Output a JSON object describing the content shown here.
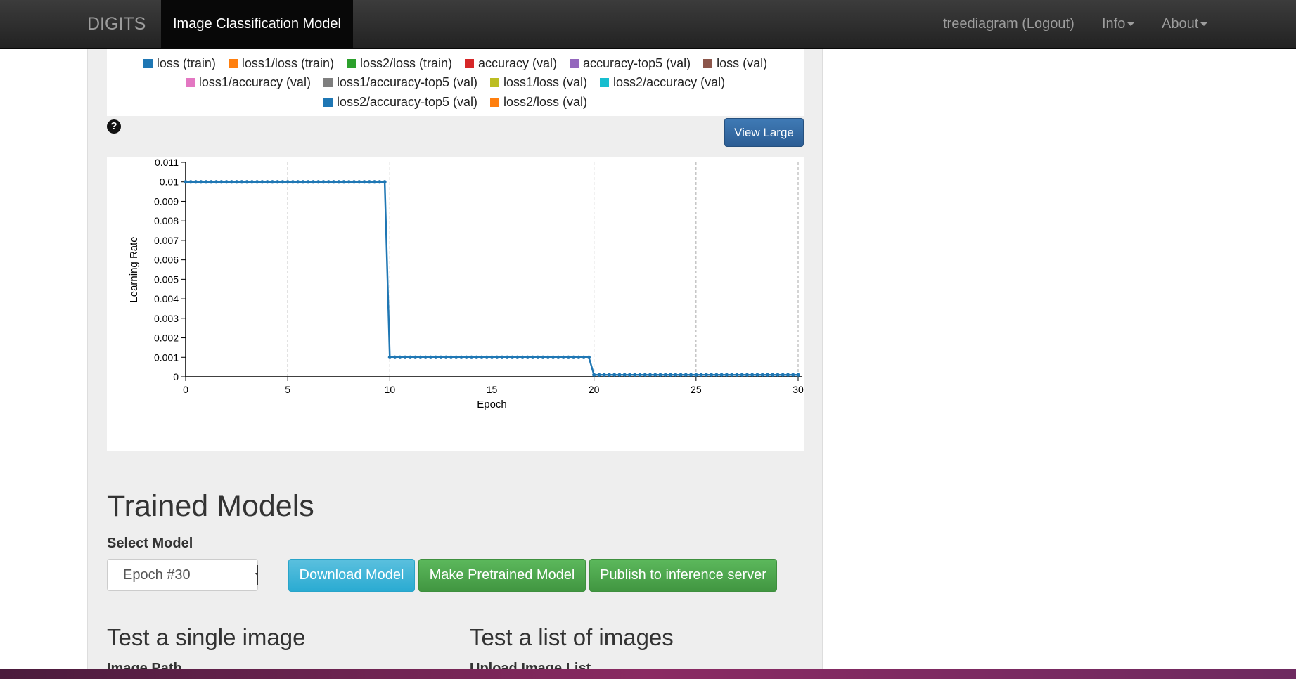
{
  "navbar": {
    "brand": "DIGITS",
    "active_tab": "Image Classification Model",
    "user_link": "treediagram (Logout)",
    "info_menu": "Info",
    "about_menu": "About"
  },
  "legend": {
    "items": [
      {
        "label": "loss (train)",
        "color": "#1f77b4"
      },
      {
        "label": "loss1/loss (train)",
        "color": "#ff7f0e"
      },
      {
        "label": "loss2/loss (train)",
        "color": "#2ca02c"
      },
      {
        "label": "accuracy (val)",
        "color": "#d62728"
      },
      {
        "label": "accuracy-top5 (val)",
        "color": "#9467bd"
      },
      {
        "label": "loss (val)",
        "color": "#8c564b"
      },
      {
        "label": "loss1/accuracy (val)",
        "color": "#e377c2"
      },
      {
        "label": "loss1/accuracy-top5 (val)",
        "color": "#7f7f7f"
      },
      {
        "label": "loss1/loss (val)",
        "color": "#bcbd22"
      },
      {
        "label": "loss2/accuracy (val)",
        "color": "#17becf"
      },
      {
        "label": "loss2/accuracy-top5 (val)",
        "color": "#1f77b4"
      },
      {
        "label": "loss2/loss (val)",
        "color": "#ff7f0e"
      }
    ]
  },
  "help_icon_glyph": "?",
  "view_large_label": "View Large",
  "chart_data": {
    "type": "line",
    "xlabel": "Epoch",
    "ylabel": "Learning Rate",
    "xlim": [
      0,
      30
    ],
    "ylim": [
      0,
      0.011
    ],
    "x_ticks": [
      "0",
      "5",
      "10",
      "15",
      "20",
      "25",
      "30"
    ],
    "y_ticks": [
      "0",
      "0.001",
      "0.002",
      "0.003",
      "0.004",
      "0.005",
      "0.006",
      "0.007",
      "0.008",
      "0.009",
      "0.01",
      "0.011"
    ],
    "grid": "vertical dashed at x ticks",
    "line_color": "#1f77b4",
    "series": [
      {
        "name": "",
        "segments": [
          {
            "x_from": 0,
            "x_to": 10,
            "y": 0.01
          },
          {
            "x_from": 10,
            "x_to": 20,
            "y": 0.001
          },
          {
            "x_from": 20,
            "x_to": 30,
            "y": 0.0001
          }
        ],
        "points_per_epoch": 4
      }
    ]
  },
  "trained_models": {
    "heading": "Trained Models",
    "select_label": "Select Model",
    "selected": "Epoch #30",
    "download_button": "Download Model",
    "pretrained_button": "Make Pretrained Model",
    "publish_button": "Publish to inference server"
  },
  "test_single": {
    "heading": "Test a single image",
    "field_label": "Image Path"
  },
  "test_list": {
    "heading": "Test a list of images",
    "field_label": "Upload Image List"
  }
}
